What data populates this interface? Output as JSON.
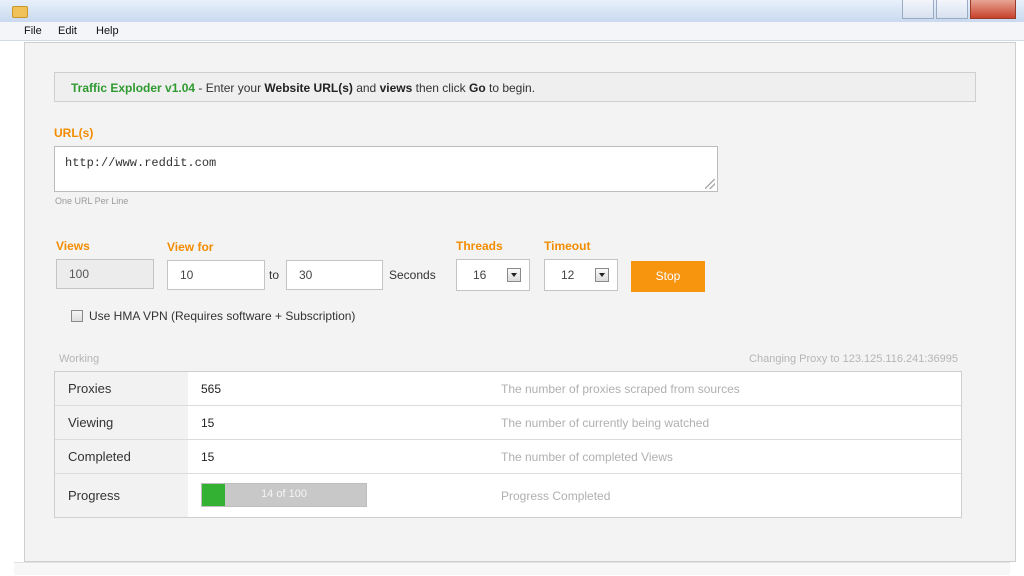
{
  "menu": [
    "File",
    "Edit",
    "Help"
  ],
  "header": {
    "app_name": "Traffic Exploder v1.04",
    "part1": " - Enter your ",
    "bold1": "Website URL(s)",
    "part2": " and ",
    "bold2": "views",
    "part3": " then click ",
    "bold3": "Go",
    "part4": " to begin."
  },
  "url_section": {
    "label": "URL(s)",
    "value": "http://www.reddit.com",
    "hint": "One URL Per Line"
  },
  "controls": {
    "views_label": "Views",
    "views_value": "100",
    "view_for_label": "View for",
    "view_for_min": "10",
    "to_text": "to",
    "view_for_max": "30",
    "seconds_text": "Seconds",
    "threads_label": "Threads",
    "threads_value": "16",
    "timeout_label": "Timeout",
    "timeout_value": "12",
    "stop_label": "Stop"
  },
  "vpn": {
    "checked": false,
    "label": "Use HMA VPN (Requires software + Subscription)"
  },
  "status": {
    "left": "Working",
    "right": "Changing Proxy to 123.125.116.241:36995"
  },
  "stats": [
    {
      "label": "Proxies",
      "value": "565",
      "desc": "The number of proxies scraped from sources"
    },
    {
      "label": "Viewing",
      "value": "15",
      "desc": "The number of currently being watched"
    },
    {
      "label": "Completed",
      "value": "15",
      "desc": "The number of completed Views"
    }
  ],
  "progress": {
    "label": "Progress",
    "text": "14 of 100",
    "fraction": 0.14,
    "desc": "Progress Completed",
    "fill_color": "#32b132"
  },
  "colors": {
    "accent_orange": "#f7950f",
    "label_orange": "#f28c00",
    "title_green": "#2f9a2f"
  }
}
